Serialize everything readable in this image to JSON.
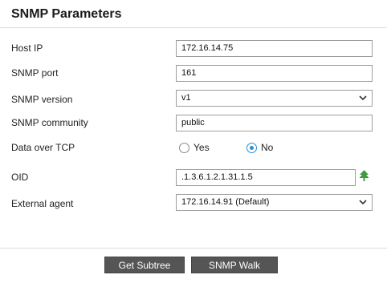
{
  "panel": {
    "title": "SNMP Parameters"
  },
  "fields": {
    "host_ip": {
      "label": "Host IP",
      "value": "172.16.14.75"
    },
    "snmp_port": {
      "label": "SNMP port",
      "value": "161"
    },
    "snmp_version": {
      "label": "SNMP version",
      "value": "v1"
    },
    "snmp_community": {
      "label": "SNMP community",
      "value": "public"
    },
    "data_over_tcp": {
      "label": "Data over TCP",
      "options": [
        {
          "label": "Yes",
          "checked": false
        },
        {
          "label": "No",
          "checked": true
        }
      ]
    },
    "oid": {
      "label": "OID",
      "value": ".1.3.6.1.2.1.31.1.5",
      "icon": "tree-icon"
    },
    "external_agent": {
      "label": "External agent",
      "value": "172.16.14.91 (Default)"
    }
  },
  "buttons": {
    "get_subtree": "Get Subtree",
    "snmp_walk": "SNMP Walk"
  },
  "colors": {
    "radio_accent": "#2a8fd6",
    "button_bg": "#555555",
    "tree_icon": "#3f9b3f"
  }
}
